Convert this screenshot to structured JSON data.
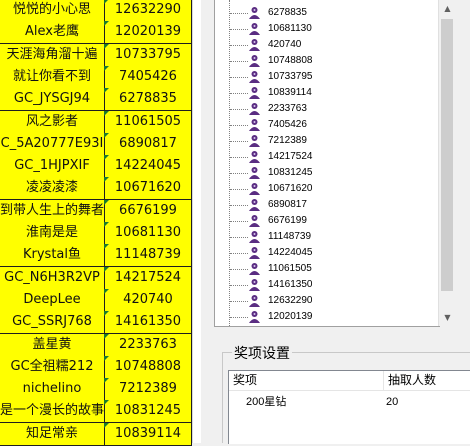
{
  "sheet_rows": [
    {
      "name": "悦悦的小心思",
      "value": "12632290"
    },
    {
      "name": "Alex老鹰",
      "value": "12020139"
    },
    {
      "name": "天涯海角溜十遍",
      "value": "10733795"
    },
    {
      "name": "就让你看不到",
      "value": "7405426"
    },
    {
      "name": "GC_JYSGJ94",
      "value": "6278835"
    },
    {
      "name": "风之影者",
      "value": "11061505"
    },
    {
      "name": "C_5A20777E93I",
      "value": "6890817"
    },
    {
      "name": "GC_1HJPXIF",
      "value": "14224045"
    },
    {
      "name": "凌凌凌漆",
      "value": "10671620"
    },
    {
      "name": "到带人生上的舞者",
      "value": "6676199"
    },
    {
      "name": "淮南是是",
      "value": "10681130"
    },
    {
      "name": "Krystal鱼",
      "value": "11148739"
    },
    {
      "name": "GC_N6H3R2VP",
      "value": "14217524"
    },
    {
      "name": "DeepLee",
      "value": "420740"
    },
    {
      "name": "GC_SSRJ768",
      "value": "14161350"
    },
    {
      "name": "盖星黄",
      "value": "2233763"
    },
    {
      "name": "GC全祖糯212",
      "value": "10748808"
    },
    {
      "name": "nichelino",
      "value": "7212389"
    },
    {
      "name": "是一个漫长的故事",
      "value": "10831245"
    },
    {
      "name": "知足常亲",
      "value": "10839114"
    }
  ],
  "tree_items": [
    "6278835",
    "10681130",
    "420740",
    "10748808",
    "10733795",
    "10839114",
    "2233763",
    "7405426",
    "7212389",
    "14217524",
    "10831245",
    "10671620",
    "6890817",
    "6676199",
    "11148739",
    "14224045",
    "11061505",
    "14161350",
    "12632290",
    "12020139"
  ],
  "award_settings": {
    "title": "奖项设置",
    "columns": [
      "奖项",
      "抽取人数"
    ],
    "rows": [
      {
        "award": "200星钻",
        "count": "20"
      }
    ]
  },
  "colors": {
    "sheet_fill": "#ffff00",
    "tree_icon": "#5a2d82"
  }
}
